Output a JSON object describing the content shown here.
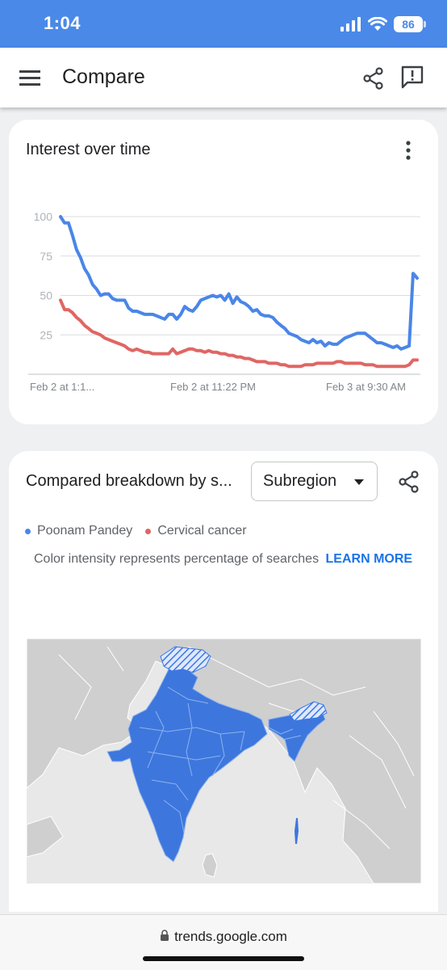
{
  "status_bar": {
    "time": "1:04",
    "battery": "86",
    "icons": [
      "signal-icon",
      "wifi-icon",
      "battery-icon"
    ]
  },
  "app_bar": {
    "title": "Compare",
    "icons": [
      "menu-icon",
      "share-icon",
      "feedback-icon"
    ]
  },
  "interest_card": {
    "title": "Interest over time",
    "chart_data": {
      "type": "line",
      "title": "Interest over time",
      "y_ticks": [
        "100",
        "75",
        "50",
        "25"
      ],
      "ylim": [
        0,
        100
      ],
      "x_labels": [
        "Feb 2 at 1:1...",
        "Feb 2 at 11:22 PM",
        "Feb 3 at 9:30 AM"
      ],
      "grid": true,
      "series": [
        {
          "name": "Poonam Pandey",
          "color": "#4a86e8",
          "values": [
            100,
            96,
            96,
            88,
            79,
            74,
            67,
            63,
            57,
            54,
            50,
            51,
            51,
            48,
            47,
            47,
            47,
            42,
            40,
            40,
            39,
            38,
            38,
            38,
            37,
            36,
            35,
            38,
            38,
            35,
            38,
            43,
            41,
            40,
            43,
            47,
            48,
            49,
            50,
            49,
            50,
            47,
            51,
            45,
            49,
            46,
            45,
            43,
            40,
            41,
            38,
            37,
            37,
            36,
            33,
            31,
            29,
            26,
            25,
            24,
            22,
            21,
            20,
            22,
            20,
            21,
            18,
            20,
            19,
            19,
            21,
            23,
            24,
            25,
            26,
            26,
            26,
            24,
            22,
            20,
            20,
            19,
            18,
            17,
            18,
            16,
            17,
            18,
            64,
            61
          ]
        },
        {
          "name": "Cervical cancer",
          "color": "#e06663",
          "values": [
            47,
            41,
            41,
            39,
            36,
            34,
            31,
            29,
            27,
            26,
            25,
            23,
            22,
            21,
            20,
            19,
            18,
            16,
            15,
            16,
            15,
            14,
            14,
            13,
            13,
            13,
            13,
            13,
            16,
            13,
            14,
            15,
            16,
            16,
            15,
            15,
            14,
            15,
            14,
            14,
            13,
            13,
            12,
            12,
            11,
            11,
            10,
            10,
            9,
            8,
            8,
            8,
            7,
            7,
            7,
            6,
            6,
            5,
            5,
            5,
            5,
            6,
            6,
            6,
            7,
            7,
            7,
            7,
            7,
            8,
            8,
            7,
            7,
            7,
            7,
            7,
            6,
            6,
            6,
            5,
            5,
            5,
            5,
            5,
            5,
            5,
            5,
            6,
            9,
            9
          ]
        }
      ]
    }
  },
  "breakdown_card": {
    "title": "Compared breakdown by s...",
    "select_value": "Subregion",
    "legend": [
      {
        "label": "Poonam Pandey",
        "color": "#4a86e8"
      },
      {
        "label": "Cervical cancer",
        "color": "#e06663"
      }
    ],
    "note": "Color intensity represents percentage of searches",
    "learn_more": "LEARN MORE"
  },
  "url_bar": {
    "url": "trends.google.com"
  }
}
